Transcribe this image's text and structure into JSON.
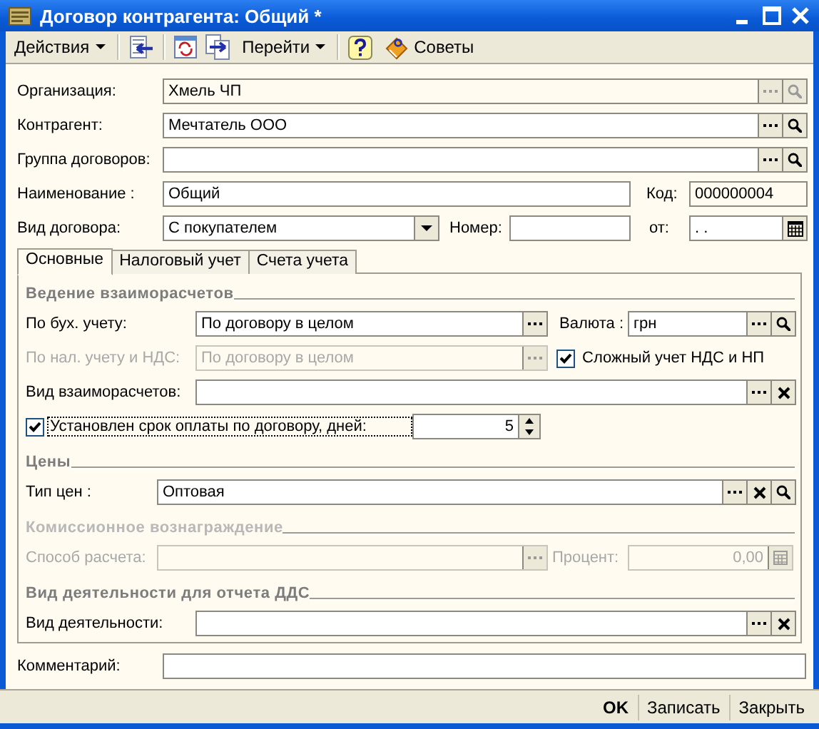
{
  "window": {
    "title": "Договор контрагента: Общий *"
  },
  "toolbar": {
    "actions_menu": "Действия",
    "goto_menu": "Перейти",
    "tips_button": "Советы"
  },
  "header": {
    "organization": {
      "label": "Организация:",
      "value": "Хмель ЧП",
      "readonly": true,
      "buttons": [
        {
          "kind": "choose"
        },
        {
          "kind": "search"
        }
      ]
    },
    "counterparty": {
      "label": "Контрагент:",
      "value": "Мечтатель ООО",
      "readonly": false,
      "buttons": [
        {
          "kind": "choose"
        },
        {
          "kind": "search"
        }
      ]
    },
    "group": {
      "label": "Группа договоров:",
      "readonly": false,
      "buttons": [
        {
          "kind": "choose"
        },
        {
          "kind": "search"
        }
      ]
    },
    "name": {
      "label": "Наименование :",
      "value": "Общий",
      "readonly": false
    },
    "code": {
      "label": "Код:",
      "value": "000000004",
      "readonly": true
    },
    "contract_type": {
      "label": "Вид договора:",
      "value": "С покупателем",
      "readonly": false,
      "buttons": [
        {
          "kind": "dropdown"
        }
      ]
    },
    "number": {
      "label": "Номер:",
      "readonly": false
    },
    "date": {
      "label": "от:",
      "value": ". .",
      "readonly": false,
      "buttons": [
        {
          "kind": "calendar"
        }
      ]
    }
  },
  "tabs": [
    {
      "label": "Основные",
      "selected": true
    },
    {
      "label": "Налоговый учет",
      "selected": false
    },
    {
      "label": "Счета учета",
      "selected": false
    }
  ],
  "settlements": {
    "title": "Ведение взаиморасчетов",
    "disabled": false,
    "accounting": {
      "label": "По бух. учету:",
      "value": "По договору в целом",
      "disabled": false,
      "buttons": [
        {
          "kind": "choose"
        }
      ]
    },
    "currency": {
      "label": "Валюта :",
      "value": "грн",
      "disabled": false,
      "buttons": [
        {
          "kind": "choose"
        },
        {
          "kind": "search"
        }
      ]
    },
    "tax_accounting": {
      "label": "По нал. учету и НДС:",
      "value": "По договору в целом",
      "disabled": true,
      "buttons": [
        {
          "kind": "choose"
        }
      ]
    },
    "complex_vat": {
      "label": "Сложный  учет НДС и НП",
      "checked": true,
      "focused": false
    },
    "settlement_type": {
      "label": "Вид взаиморасчетов:",
      "disabled": false,
      "buttons": [
        {
          "kind": "choose"
        },
        {
          "kind": "clear"
        }
      ]
    },
    "payment_term": {
      "label": "Установлен срок оплаты по договору, дней:",
      "checked": true,
      "focused": true,
      "value": "5",
      "buttons": [
        {
          "kind": "spin"
        }
      ]
    }
  },
  "prices": {
    "title": "Цены",
    "disabled": false,
    "price_type": {
      "label": "Тип цен :",
      "value": "Оптовая",
      "disabled": false,
      "buttons": [
        {
          "kind": "choose"
        },
        {
          "kind": "clear"
        },
        {
          "kind": "search"
        }
      ]
    }
  },
  "commission": {
    "title": "Комиссионное вознаграждение",
    "disabled": true,
    "method": {
      "label": "Способ расчета:",
      "disabled": true,
      "buttons": [
        {
          "kind": "choose"
        }
      ]
    },
    "percent": {
      "label": "Процент:",
      "value": "0,00",
      "disabled": true,
      "buttons": [
        {
          "kind": "calculator"
        }
      ]
    }
  },
  "cash_flow": {
    "title": "Вид деятельности для отчета ДДС",
    "disabled": false,
    "activity": {
      "label": "Вид деятельности:",
      "disabled": false,
      "buttons": [
        {
          "kind": "choose"
        },
        {
          "kind": "clear"
        }
      ]
    }
  },
  "comment": {
    "label": "Комментарий:",
    "disabled": false
  },
  "footer": [
    {
      "label": "OK",
      "default": true
    },
    {
      "label": "Записать",
      "default": false
    },
    {
      "label": "Закрыть",
      "default": false
    }
  ]
}
